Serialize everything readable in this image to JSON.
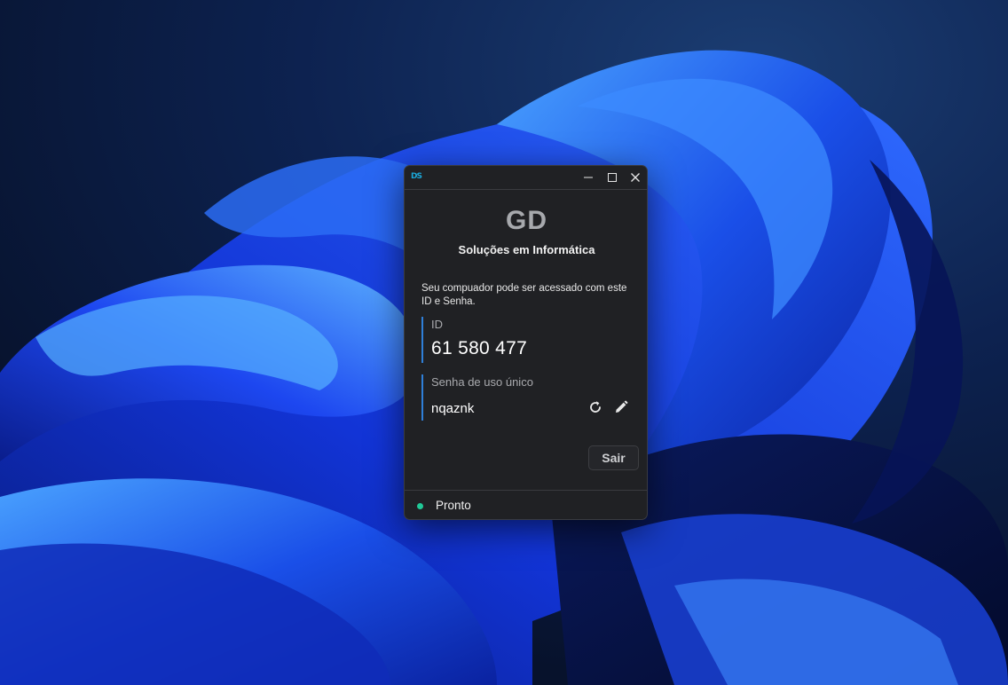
{
  "window": {
    "app_logo": "DS",
    "controls": {
      "minimize": "minimize",
      "maximize": "maximize",
      "close": "close"
    }
  },
  "brand": {
    "title": "GD",
    "subtitle": "Soluções em Informática"
  },
  "info": {
    "text": "Seu compuador pode ser acessado com este ID e Senha."
  },
  "id_field": {
    "label": "ID",
    "value": "61 580 477"
  },
  "password_field": {
    "label": "Senha de uso único",
    "value": "nqaznk",
    "refresh_icon": "refresh-icon",
    "edit_icon": "pencil-icon"
  },
  "actions": {
    "exit_label": "Sair"
  },
  "status": {
    "text": "Pronto",
    "color": "#20c997"
  },
  "colors": {
    "accent": "#2f7fd8",
    "window_bg": "#202124",
    "desktop_bg": "#0b1a3a"
  }
}
